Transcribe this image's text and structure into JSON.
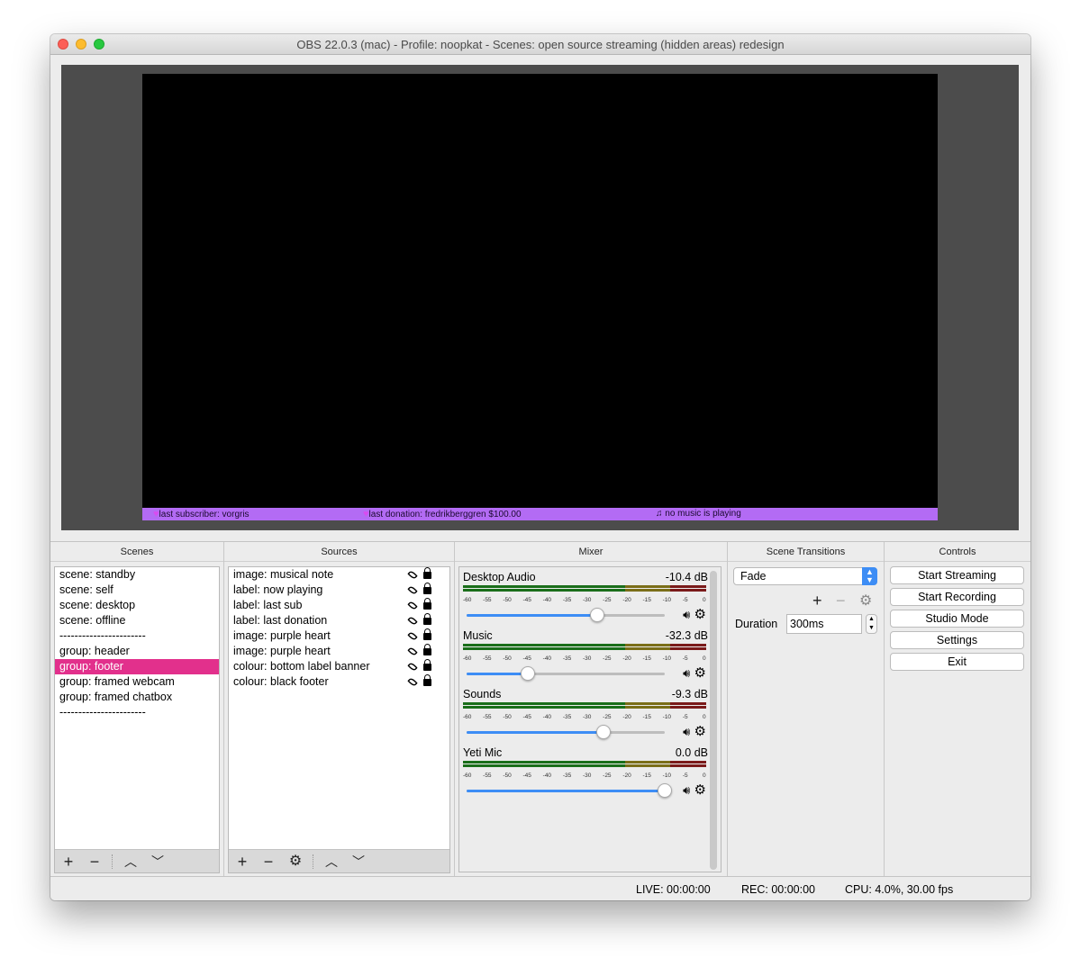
{
  "window": {
    "title": "OBS 22.0.3 (mac) - Profile: noopkat - Scenes: open source streaming (hidden areas) redesign"
  },
  "preview": {
    "footer": {
      "subscriber": "last subscriber: vorgris",
      "donation": "last donation: fredrikberggren $100.00",
      "music": "no music is playing"
    }
  },
  "scenes": {
    "title": "Scenes",
    "items": [
      "scene: standby",
      "scene: self",
      "scene: desktop",
      "scene: offline",
      "-----------------------",
      "group: header",
      "group: footer",
      "group: framed webcam",
      "group: framed chatbox",
      "-----------------------"
    ],
    "selected_index": 6
  },
  "sources": {
    "title": "Sources",
    "items": [
      "image: musical note",
      "label: now playing",
      "label: last sub",
      "label: last donation",
      "image: purple heart",
      "image: purple heart",
      "colour: bottom label banner",
      "colour: black footer"
    ]
  },
  "mixer": {
    "title": "Mixer",
    "ticks": [
      "-60",
      "-55",
      "-50",
      "-45",
      "-40",
      "-35",
      "-30",
      "-25",
      "-20",
      "-15",
      "-10",
      "-5",
      "0"
    ],
    "channels": [
      {
        "name": "Desktop Audio",
        "db": "-10.4 dB",
        "volume": 0.66
      },
      {
        "name": "Music",
        "db": "-32.3 dB",
        "volume": 0.31
      },
      {
        "name": "Sounds",
        "db": "-9.3 dB",
        "volume": 0.69
      },
      {
        "name": "Yeti Mic",
        "db": "0.0 dB",
        "volume": 1.0
      }
    ]
  },
  "transitions": {
    "title": "Scene Transitions",
    "selected": "Fade",
    "duration_label": "Duration",
    "duration_value": "300ms"
  },
  "controls": {
    "title": "Controls",
    "start_streaming": "Start Streaming",
    "start_recording": "Start Recording",
    "studio_mode": "Studio Mode",
    "settings": "Settings",
    "exit": "Exit"
  },
  "status": {
    "live": "LIVE: 00:00:00",
    "rec": "REC: 00:00:00",
    "cpu": "CPU: 4.0%, 30.00 fps"
  }
}
